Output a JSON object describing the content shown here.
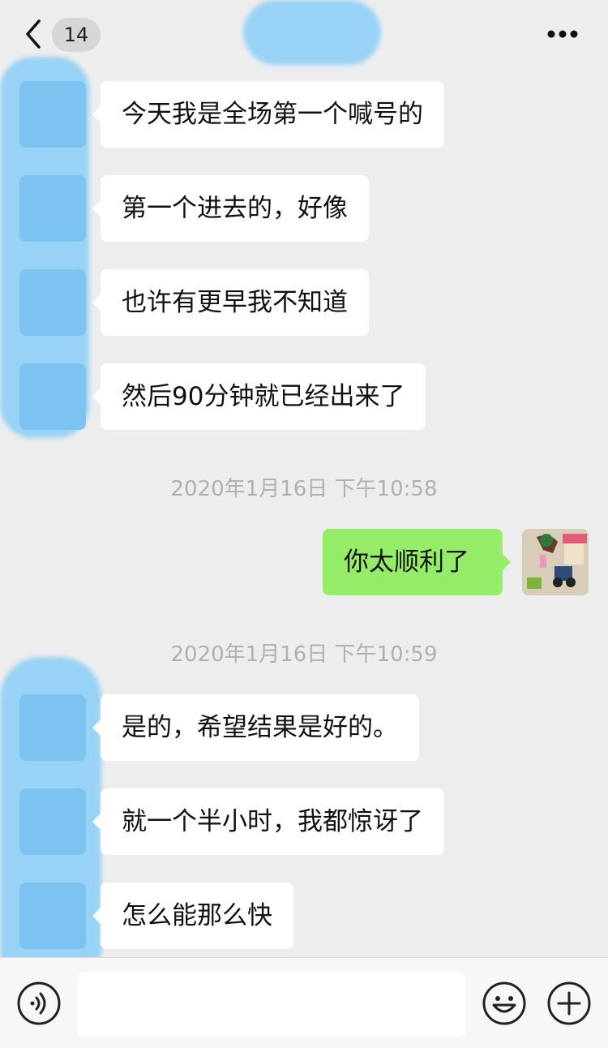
{
  "header": {
    "unread_count": "14"
  },
  "messages": [
    {
      "text": "今天我是全场第一个喊号的"
    },
    {
      "text": "第一个进去的，好像"
    },
    {
      "text": "也许有更早我不知道"
    },
    {
      "text": "然后90分钟就已经出来了"
    }
  ],
  "timestamps": [
    "2020年1月16日 下午10:58",
    "2020年1月16日 下午10:59"
  ],
  "my_message": {
    "text": "你太顺利了"
  },
  "messages2": [
    {
      "text": "是的，希望结果是好的。"
    },
    {
      "text": "就一个半小时，我都惊讶了"
    },
    {
      "text": "怎么能那么快"
    }
  ],
  "input": {
    "value": ""
  },
  "colors": {
    "bubble_self": "#95ec69",
    "bubble_other": "#ffffff",
    "background": "#ededed"
  }
}
